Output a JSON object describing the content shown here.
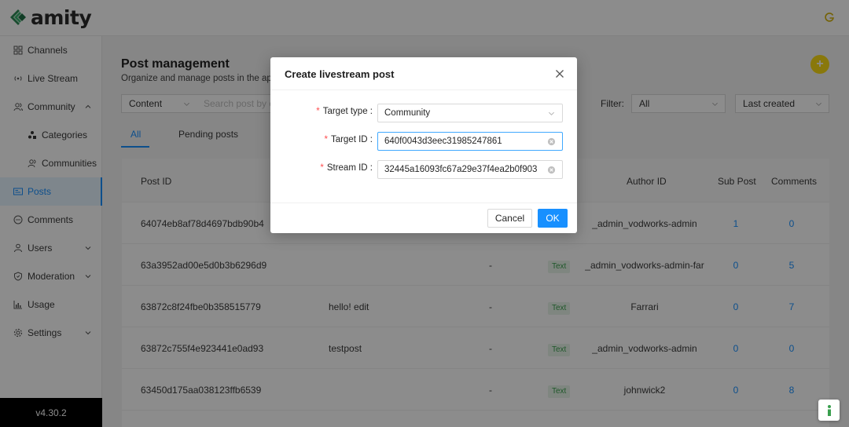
{
  "app": {
    "brand": "amity",
    "version": "v4.30.2"
  },
  "sidebar": {
    "items": [
      {
        "label": "Channels",
        "icon": "grid-icon"
      },
      {
        "label": "Live Stream",
        "icon": "broadcast-icon"
      },
      {
        "label": "Community",
        "icon": "users-icon",
        "expanded": true
      },
      {
        "label": "Categories",
        "icon": "categories-icon",
        "sub": true
      },
      {
        "label": "Communities",
        "icon": "users-icon",
        "sub": true
      },
      {
        "label": "Posts",
        "icon": "posts-icon",
        "active": true
      },
      {
        "label": "Comments",
        "icon": "comment-icon"
      },
      {
        "label": "Users",
        "icon": "user-icon"
      },
      {
        "label": "Moderation",
        "icon": "moderation-icon"
      },
      {
        "label": "Usage",
        "icon": "bar-chart-icon"
      },
      {
        "label": "Settings",
        "icon": "gear-icon"
      }
    ]
  },
  "page": {
    "title": "Post management",
    "subtitle": "Organize and manage posts in the appl"
  },
  "filters": {
    "content_select": "Content",
    "search_placeholder": "Search post by co",
    "filter_label": "Filter:",
    "filter_value": "All",
    "sort_value": "Last created"
  },
  "tabs": [
    "All",
    "Pending posts"
  ],
  "table": {
    "headers": {
      "post_id": "Post ID",
      "author_id": "Author ID",
      "sub_post": "Sub Post",
      "comments": "Comments"
    },
    "rows": [
      {
        "post_id": "64074eb8af78d4697bdb90b4",
        "text": "",
        "dash": "",
        "tag": "",
        "author": "_admin_vodworks-admin",
        "sub": "1",
        "comments": "0"
      },
      {
        "post_id": "63a3952ad00e5d0b3b6296d9",
        "text": "",
        "dash": "-",
        "tag": "Text",
        "author": "_admin_vodworks-admin-far",
        "sub": "0",
        "comments": "5"
      },
      {
        "post_id": "63872c8f24fbe0b358515779",
        "text": "hello! edit",
        "dash": "-",
        "tag": "Text",
        "author": "Farrari",
        "sub": "0",
        "comments": "7"
      },
      {
        "post_id": "63872c755f4e923441e0ad93",
        "text": "testpost",
        "dash": "-",
        "tag": "Text",
        "author": "_admin_vodworks-admin",
        "sub": "0",
        "comments": "0"
      },
      {
        "post_id": "63450d175aa038123ffb6539",
        "text": "",
        "dash": "-",
        "tag": "Text",
        "author": "johnwick2",
        "sub": "0",
        "comments": "8"
      }
    ]
  },
  "modal": {
    "title": "Create livestream post",
    "fields": {
      "target_type": {
        "label": "Target type",
        "value": "Community"
      },
      "target_id": {
        "label": "Target ID",
        "value": "640f0043d3eec31985247861"
      },
      "stream_id": {
        "label": "Stream ID",
        "value": "32445a16093fc67a29e37f4ea2b0f903"
      }
    },
    "cancel_label": "Cancel",
    "ok_label": "OK"
  },
  "colors": {
    "primary": "#1890ff",
    "brand_green": "#3a9f4e",
    "accent_yellow": "#fadb14"
  }
}
